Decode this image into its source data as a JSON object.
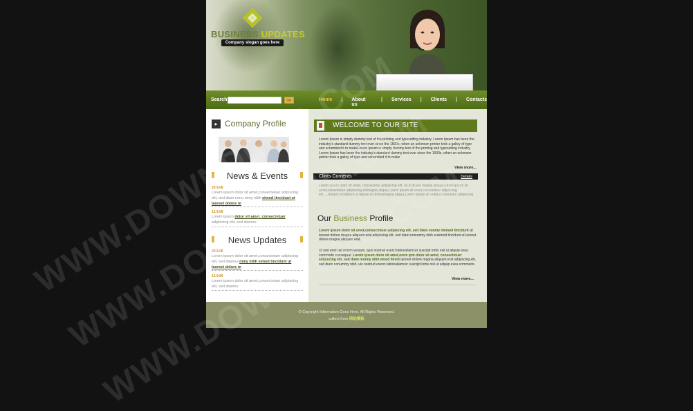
{
  "header": {
    "logo_word1": "BUSINESS",
    "logo_word2": "UPDATES",
    "slogan": "Company slogan goes here"
  },
  "nav": {
    "search_label": "Search",
    "search_button": "OK",
    "items": [
      {
        "label": "Home",
        "active": true
      },
      {
        "label": "About us"
      },
      {
        "label": "Services"
      },
      {
        "label": "Clients"
      },
      {
        "label": "Contacts"
      }
    ]
  },
  "left": {
    "company_profile_title": "Company Profile",
    "news_events": {
      "title": "News & Events",
      "items": [
        {
          "date": "20.9.06",
          "text": "Lorem ipsum dolor sit amet,consectetuer adipiscing elit, sed diam nonu mmy nibh ",
          "link": "eimod tincidunt ut laoreet dolore m"
        },
        {
          "date": "12.9.06",
          "text": "Lorem ipsum ",
          "link": "dolor sit amet, consectetuer",
          "tail": " adipiscing elit, sed diamnu"
        }
      ]
    },
    "news_updates": {
      "title": "News Updates",
      "items": [
        {
          "date": "20.9.06",
          "text": "Lorem ipsum dolor sit amet,consectetuer adipiscing elit, sed diamnu ",
          "link": "mmy nibh eimod tincidunt ut laoreet dolore m"
        },
        {
          "date": "12.9.06",
          "text": "Lorem ipsum dolor sit amet,consectetuer adipiscing elit, sed diamnu"
        }
      ]
    }
  },
  "right": {
    "welcome_title": "WELCOME TO OUR SITE",
    "welcome_text": "Lorem Ipsum is simply dummy text of the printing and typesetting industry. Lorem Ipsum has been the industry's standard dummy text ever since the 1500s, when an unknown printer took a galley of type and scrambled it to makeLorem Ipsum is simply dummy text of the printing and typesetting industry. Lorem Ipsum has been the industry's standard dummy text ever since the 1500s, when an unknown printer took a galley of type and scrambled it to make",
    "view_more_1": "View more...",
    "clints_title": "Clints Coments",
    "clints_link": "Details",
    "clints_text": "Lorem ipsum dolor sit amet, consectetur adipiscing elit, se d do eiu magna aliqua.Lorem ipsum sit amet,consectetur adipiscing elitmagna aliqua.Lorem ipsum sit amet,consectetur adipiscing elit.....tempor incididunt ut labore et doloremagna aliqua.Lorem ipsum sit amet,consectetur adipiscing",
    "profile_title_1": "Our ",
    "profile_title_2": "Business",
    "profile_title_3": " Profile",
    "profile_bold_1": "Lorem ipsum dolor sit amet,consectetuer adipiscing elit, sed diam nonmy nlemod tincidunt ut",
    "profile_text_1": " laoreet dolore magna aliquam erat adipiscing elit, sed diam nonummy nibh euismod tincidunt ut laoreet dolore magna aliquam erat.",
    "profile_text_2": "Ut wisi enim ad minim veniam, quis nostrud exerci tationullamcer suscipit lortis nisl ut aliquip exea commodo consequat. ",
    "profile_bold_2": "Lorem ipsum dolor sit amet,orem ipm dolor sit amet, consectetuer adipiscing elit, sed diam nonmy nibh emod tlevnt",
    "profile_text_3": " laoreet dolore magna aliquam erat adipiscing elit, sed diam nonummy nibh .uis nostrud exerci tationullamcer suscipit lortis nisl ut aliquip exea commodo.",
    "view_more_2": "View more..."
  },
  "footer": {
    "copyright": "© Copyright Information Goes Here. All Rights Reserved.",
    "collect_label": "collect from ",
    "collect_link": "网站模板"
  },
  "watermark": "WWW.DOWNDEMO.COM"
}
